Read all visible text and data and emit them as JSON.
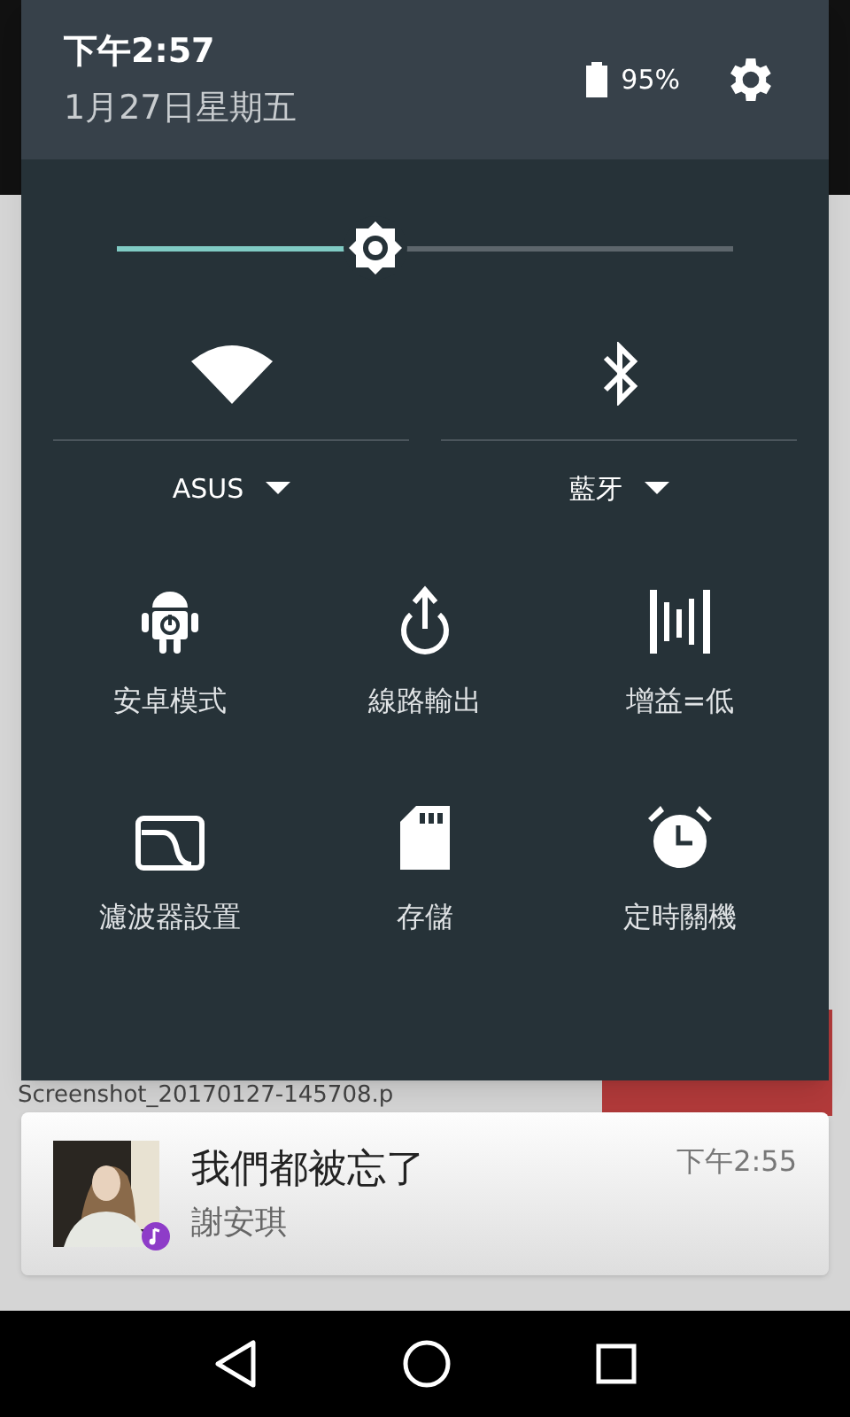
{
  "status": {
    "time": "下午2:57",
    "date": "1月27日星期五",
    "battery": "95%"
  },
  "brightness": {
    "level": 0.42
  },
  "connections": [
    {
      "kind": "wifi",
      "label": "ASUS"
    },
    {
      "kind": "bluetooth",
      "label": "藍牙"
    }
  ],
  "tiles": [
    {
      "kind": "android",
      "label": "安卓模式"
    },
    {
      "kind": "lineout",
      "label": "線路輸出"
    },
    {
      "kind": "gain",
      "label": "增益=低"
    },
    {
      "kind": "filter",
      "label": "濾波器設置"
    },
    {
      "kind": "storage",
      "label": "存儲"
    },
    {
      "kind": "timer",
      "label": "定時關機"
    }
  ],
  "background": {
    "file_name": "Screenshot_20170127-145708.p"
  },
  "notification": {
    "title": "我們都被忘了",
    "artist": "謝安琪",
    "time": "下午2:55"
  }
}
